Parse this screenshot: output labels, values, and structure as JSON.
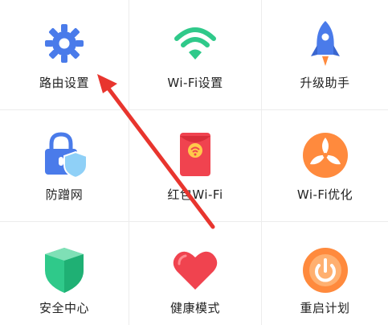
{
  "items": [
    {
      "label": "路由设置",
      "icon": "gear-icon"
    },
    {
      "label": "Wi-Fi设置",
      "icon": "wifi-icon"
    },
    {
      "label": "升级助手",
      "icon": "rocket-icon"
    },
    {
      "label": "防蹭网",
      "icon": "lock-shield-icon"
    },
    {
      "label": "红包Wi-Fi",
      "icon": "red-envelope-icon"
    },
    {
      "label": "Wi-Fi优化",
      "icon": "fan-icon"
    },
    {
      "label": "安全中心",
      "icon": "shield-icon"
    },
    {
      "label": "健康模式",
      "icon": "heart-icon"
    },
    {
      "label": "重启计划",
      "icon": "power-icon"
    }
  ],
  "colors": {
    "blue": "#4a7bea",
    "green": "#2fc98a",
    "red": "#f0434f",
    "orange": "#ff8a3d",
    "arrow": "#e8352e"
  }
}
